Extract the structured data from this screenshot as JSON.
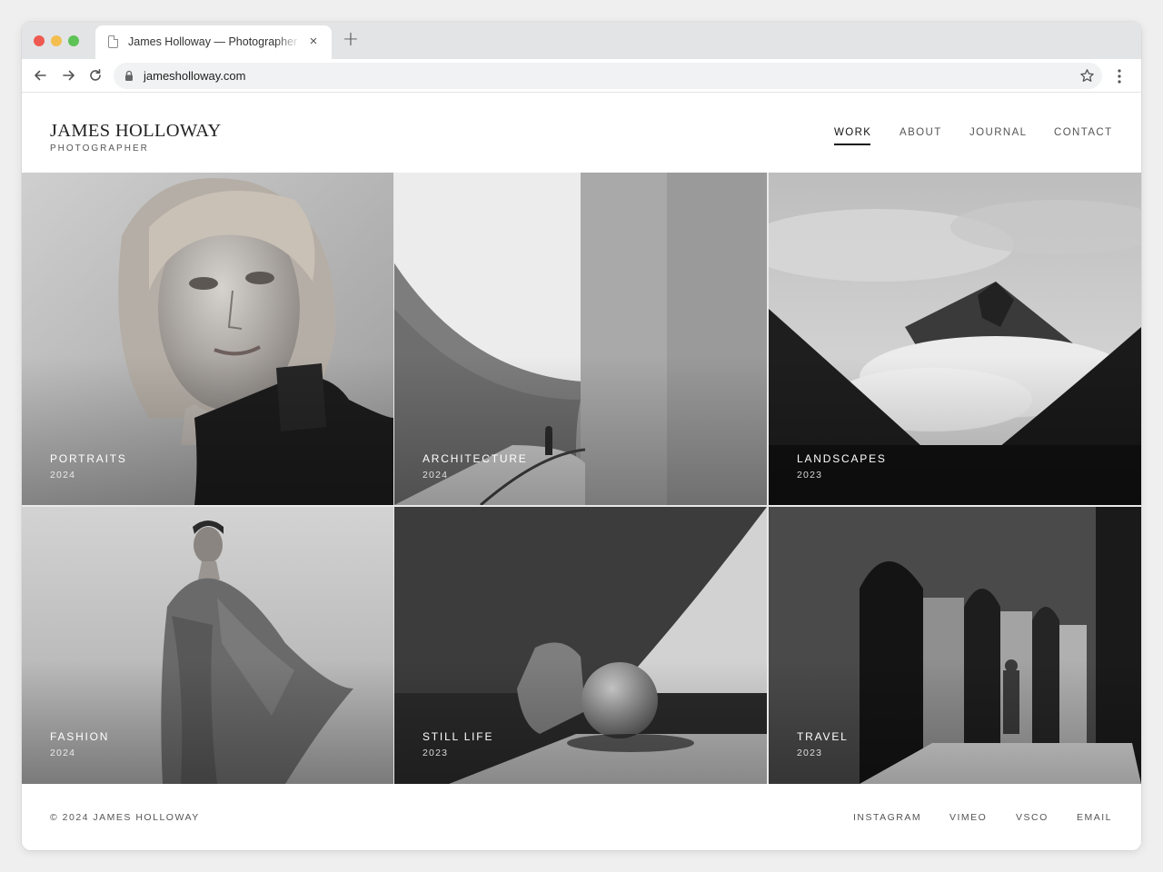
{
  "browser": {
    "tab_title": "James Holloway — Photographer",
    "tab_close": "×",
    "new_tab": "+",
    "url": "jamesholloway.com"
  },
  "site": {
    "name": "JAMES HOLLOWAY",
    "tagline": "PHOTOGRAPHER"
  },
  "nav": {
    "items": [
      {
        "label": "WORK",
        "active": true
      },
      {
        "label": "ABOUT",
        "active": false
      },
      {
        "label": "JOURNAL",
        "active": false
      },
      {
        "label": "CONTACT",
        "active": false
      }
    ]
  },
  "gallery": {
    "tiles": [
      {
        "category": "PORTRAITS",
        "year": "2024",
        "image": "portrait-woman-turtleneck"
      },
      {
        "category": "ARCHITECTURE",
        "year": "2024",
        "image": "curved-concrete-walls-figure"
      },
      {
        "category": "LANDSCAPES",
        "year": "2023",
        "image": "mountain-peak-clouds"
      },
      {
        "category": "FASHION",
        "year": "2024",
        "image": "woman-draped-coat"
      },
      {
        "category": "STILL LIFE",
        "year": "2023",
        "image": "rock-and-sphere-light"
      },
      {
        "category": "TRAVEL",
        "year": "2023",
        "image": "arched-colonnade-figure"
      }
    ]
  },
  "footer": {
    "copyright": "© 2024 JAMES HOLLOWAY",
    "links": [
      "INSTAGRAM",
      "VIMEO",
      "VSCO",
      "EMAIL"
    ]
  },
  "colors": {
    "accent": "#111111",
    "muted_text": "#555555",
    "chrome_bg": "#e3e4e6"
  }
}
